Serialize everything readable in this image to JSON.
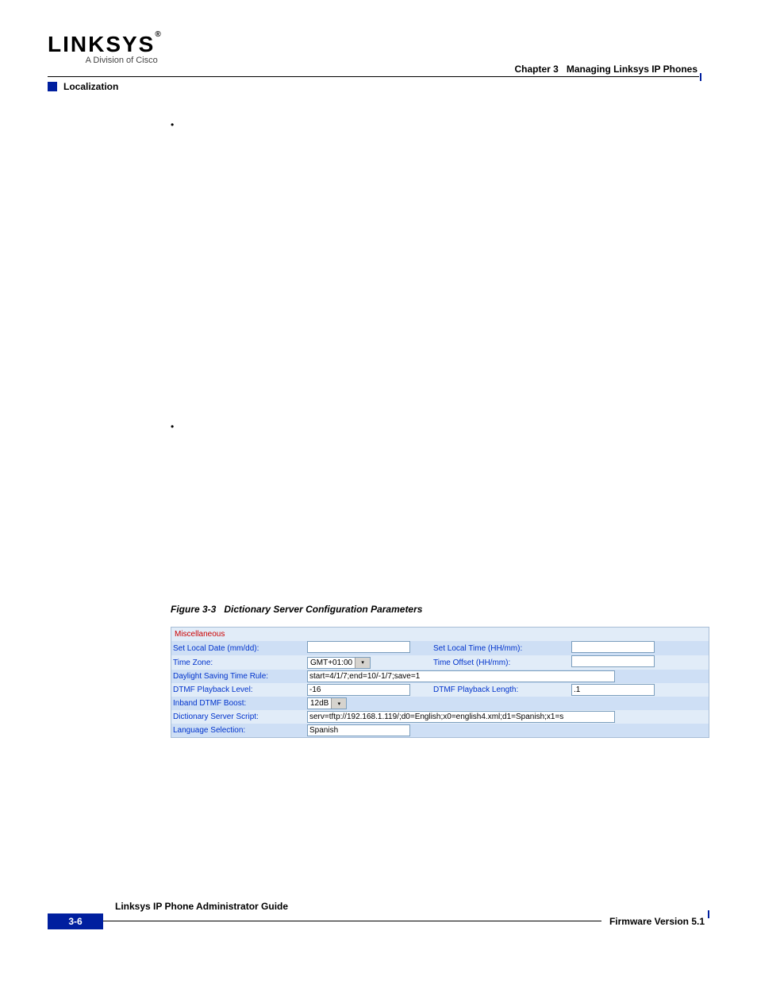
{
  "header": {
    "logo_text": "LINKSYS",
    "logo_reg": "®",
    "logo_sub": "A Division of Cisco",
    "chapter_label": "Chapter 3",
    "chapter_title": "Managing Linksys IP Phones",
    "section": "Localization"
  },
  "bullets": {
    "b1": "",
    "b2": ""
  },
  "figure": {
    "caption_num": "Figure 3-3",
    "caption_title": "Dictionary Server Configuration Parameters"
  },
  "form": {
    "section_title": "Miscellaneous",
    "rows": {
      "r1": {
        "l1": "Set Local Date (mm/dd):",
        "l2": "Set Local Time (HH/mm):"
      },
      "r2": {
        "l1": "Time Zone:",
        "v1": "GMT+01:00",
        "l2": "Time Offset (HH/mm):"
      },
      "r3": {
        "l1": "Daylight Saving Time Rule:",
        "v1": "start=4/1/7;end=10/-1/7;save=1"
      },
      "r4": {
        "l1": "DTMF Playback Level:",
        "v1": "-16",
        "l2": "DTMF Playback Length:",
        "v2": ".1"
      },
      "r5": {
        "l1": "Inband DTMF Boost:",
        "v1": "12dB"
      },
      "r6": {
        "l1": "Dictionary Server Script:",
        "v1": "serv=tftp://192.168.1.119/;d0=English;x0=english4.xml;d1=Spanish;x1=s"
      },
      "r7": {
        "l1": "Language Selection:",
        "v1": "Spanish"
      }
    }
  },
  "footer": {
    "guide": "Linksys IP Phone Administrator Guide",
    "page": "3-6",
    "firmware": "Firmware Version 5.1"
  }
}
